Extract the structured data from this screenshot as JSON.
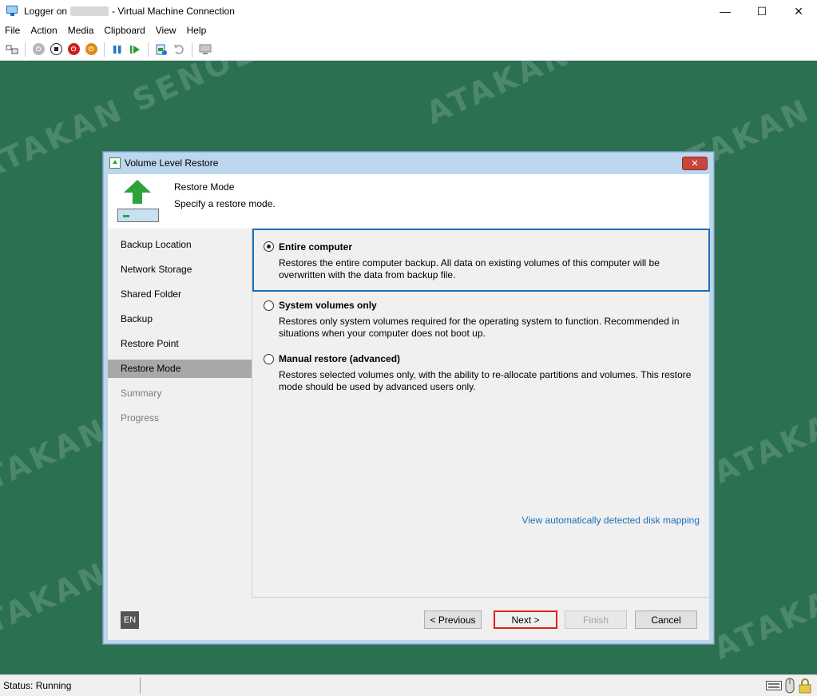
{
  "window": {
    "title_prefix": "Logger on",
    "title_suffix": "- Virtual Machine Connection",
    "minimize": "—",
    "maximize": "☐",
    "close": "✕"
  },
  "menu": [
    "File",
    "Action",
    "Media",
    "Clipboard",
    "View",
    "Help"
  ],
  "toolbar_icons": [
    "ctrl-alt-del-icon",
    "start-icon",
    "turn-off-icon",
    "shut-down-icon",
    "save-icon",
    "pause-icon",
    "reset-icon",
    "checkpoint-icon",
    "revert-icon",
    "enhanced-session-icon"
  ],
  "dialog": {
    "title": "Volume Level Restore",
    "close_label": "✕",
    "header": {
      "title": "Restore Mode",
      "subtitle": "Specify a restore mode."
    },
    "nav": [
      {
        "label": "Backup Location",
        "state": "normal"
      },
      {
        "label": "Network Storage",
        "state": "normal"
      },
      {
        "label": "Shared Folder",
        "state": "normal"
      },
      {
        "label": "Backup",
        "state": "normal"
      },
      {
        "label": "Restore Point",
        "state": "normal"
      },
      {
        "label": "Restore Mode",
        "state": "active"
      },
      {
        "label": "Summary",
        "state": "disabled"
      },
      {
        "label": "Progress",
        "state": "disabled"
      }
    ],
    "options": [
      {
        "title": "Entire computer",
        "description": "Restores the entire computer backup. All data on existing volumes of this computer will be overwritten with the data from backup file.",
        "selected": true
      },
      {
        "title": "System volumes only",
        "description": "Restores only system volumes required for the operating system to function. Recommended in situations when your computer does not boot up.",
        "selected": false
      },
      {
        "title": "Manual restore (advanced)",
        "description": "Restores selected volumes only, with the ability to re-allocate partitions and volumes. This restore mode should be used by advanced users only.",
        "selected": false
      }
    ],
    "link": "View automatically detected disk mapping",
    "language": "EN",
    "buttons": {
      "previous": "< Previous",
      "next": "Next >",
      "finish": "Finish",
      "cancel": "Cancel"
    }
  },
  "status": {
    "text": "Status: Running"
  },
  "watermark": "ATAKAN SENOL",
  "colors": {
    "vm_background": "#2b7151",
    "accent": "#1b6fb8",
    "highlight_red": "#e0201a"
  }
}
